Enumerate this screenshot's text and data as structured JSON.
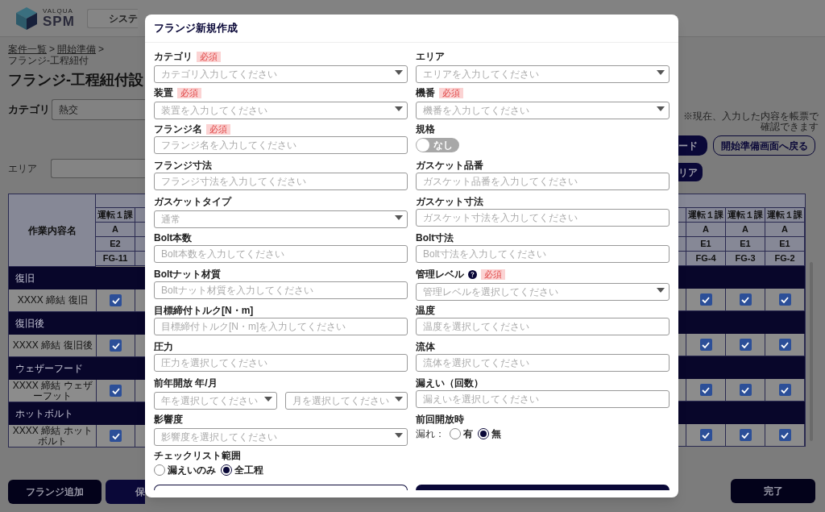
{
  "logo": {
    "brand": "VALQUA",
    "product": "SPM"
  },
  "nav": {
    "tab": "システ"
  },
  "breadcrumb_separator": ">",
  "breadcrumb": [
    {
      "label": "案件一覧",
      "link": true
    },
    {
      "label": "開始準備",
      "link": true
    },
    {
      "label": "フランジ-工程紐付",
      "link": false
    }
  ],
  "title": "フランジ-工程紐付設",
  "category": {
    "label": "カテゴリ",
    "value": "熱交"
  },
  "area": {
    "label": "エリア"
  },
  "note": "※現在、入力した内容を帳票で確認できます",
  "right_buttons": [
    {
      "label": "ード",
      "kind": "filled"
    },
    {
      "label": "開始準備画面へ戻る",
      "kind": "outline"
    }
  ],
  "area_button": "リア",
  "table": {
    "header_label": "作業内容名",
    "left_columns": [
      {
        "dept": "運転１課",
        "group": "A",
        "area": "E2",
        "flange": "FG-11"
      }
    ],
    "right_columns": [
      {
        "dept": "運転１課",
        "group": "A",
        "area": "E1",
        "flange": "FG-4"
      },
      {
        "dept": "運転１課",
        "group": "A",
        "area": "E1",
        "flange": "FG-3"
      },
      {
        "dept": "運転１課",
        "group": "A",
        "area": "E1",
        "flange": "FG-2"
      }
    ],
    "rows": [
      {
        "kind": "group",
        "label": "復旧"
      },
      {
        "kind": "item",
        "label": "XXXX 締結 復旧",
        "checked": [
          true,
          true,
          true,
          true
        ]
      },
      {
        "kind": "group",
        "label": "復旧後"
      },
      {
        "kind": "item",
        "label": "XXXX 締結 復旧後",
        "checked": [
          true,
          true,
          true,
          true
        ]
      },
      {
        "kind": "group",
        "label": "ウェザーフード"
      },
      {
        "kind": "item",
        "label": "XXXX 締結 ウェザーフット",
        "checked": [
          true,
          true,
          true,
          true
        ]
      },
      {
        "kind": "group",
        "label": "ホットボルト"
      },
      {
        "kind": "item",
        "label": "XXXX 締結 ホットボルト",
        "checked": [
          true,
          true,
          true,
          true
        ]
      }
    ]
  },
  "bottom_buttons": [
    {
      "label": "フランジ追加",
      "kind": "black"
    },
    {
      "label": "保",
      "kind": "navy"
    }
  ],
  "done_button": "完了",
  "modal": {
    "title": "フランジ新規作成",
    "left_fields": [
      {
        "kind": "select",
        "label": "カテゴリ",
        "badge": "必須",
        "placeholder": "カテゴリ入力してください"
      },
      {
        "kind": "select",
        "label": "装置",
        "badge": "必須",
        "placeholder": "装置を入力してください"
      },
      {
        "kind": "input",
        "label": "フランジ名",
        "badge": "必須",
        "placeholder": "フランジ名を入力してください"
      },
      {
        "kind": "input",
        "label": "フランジ寸法",
        "placeholder": "フランジ寸法を入力してください"
      },
      {
        "kind": "select",
        "label": "ガスケットタイプ",
        "placeholder": "通常"
      },
      {
        "kind": "input",
        "label": "Bolt本数",
        "placeholder": "Bolt本数を入力してください"
      },
      {
        "kind": "input",
        "label": "Boltナット材質",
        "placeholder": "Boltナット材質を入力してください"
      },
      {
        "kind": "input",
        "label": "目標締付トルク[N・m]",
        "placeholder": "目標締付トルク[N・m]を入力してください"
      },
      {
        "kind": "input",
        "label": "圧力",
        "placeholder": "圧力を選択してください"
      },
      {
        "kind": "dual_select",
        "label": "前年開放 年/月",
        "placeholders": [
          "年を選択してください",
          "月を選択してください"
        ]
      },
      {
        "kind": "select",
        "label": "影響度",
        "placeholder": "影響度を選択してください"
      },
      {
        "kind": "radio",
        "label": "チェックリスト範囲",
        "options": [
          {
            "label": "漏えいのみ",
            "selected": false
          },
          {
            "label": "全工程",
            "selected": true
          }
        ]
      }
    ],
    "right_fields": [
      {
        "kind": "select",
        "label": "エリア",
        "placeholder": "エリアを入力してください"
      },
      {
        "kind": "select",
        "label": "機番",
        "badge": "必須",
        "placeholder": "機番を入力してください"
      },
      {
        "kind": "toggle",
        "label": "規格",
        "on": false,
        "text": "なし"
      },
      {
        "kind": "input",
        "label": "ガスケット品番",
        "placeholder": "ガスケット品番を入力してください"
      },
      {
        "kind": "input",
        "label": "ガスケット寸法",
        "placeholder": "ガスケット寸法を入力してください"
      },
      {
        "kind": "input",
        "label": "Bolt寸法",
        "placeholder": "Bolt寸法を入力してください"
      },
      {
        "kind": "select",
        "label": "管理レベル",
        "help": true,
        "badge": "必須",
        "placeholder": "管理レベルを選択してください"
      },
      {
        "kind": "input",
        "label": "温度",
        "placeholder": "温度を選択してください"
      },
      {
        "kind": "input",
        "label": "流体",
        "placeholder": "流体を選択してください"
      },
      {
        "kind": "input",
        "label": "漏えい（回数）",
        "placeholder": "漏えいを選択してください"
      },
      {
        "kind": "radio",
        "label": "前回開放時",
        "prefix": "漏れ：",
        "options": [
          {
            "label": "有",
            "selected": false
          },
          {
            "label": "無",
            "selected": true
          }
        ]
      }
    ]
  }
}
